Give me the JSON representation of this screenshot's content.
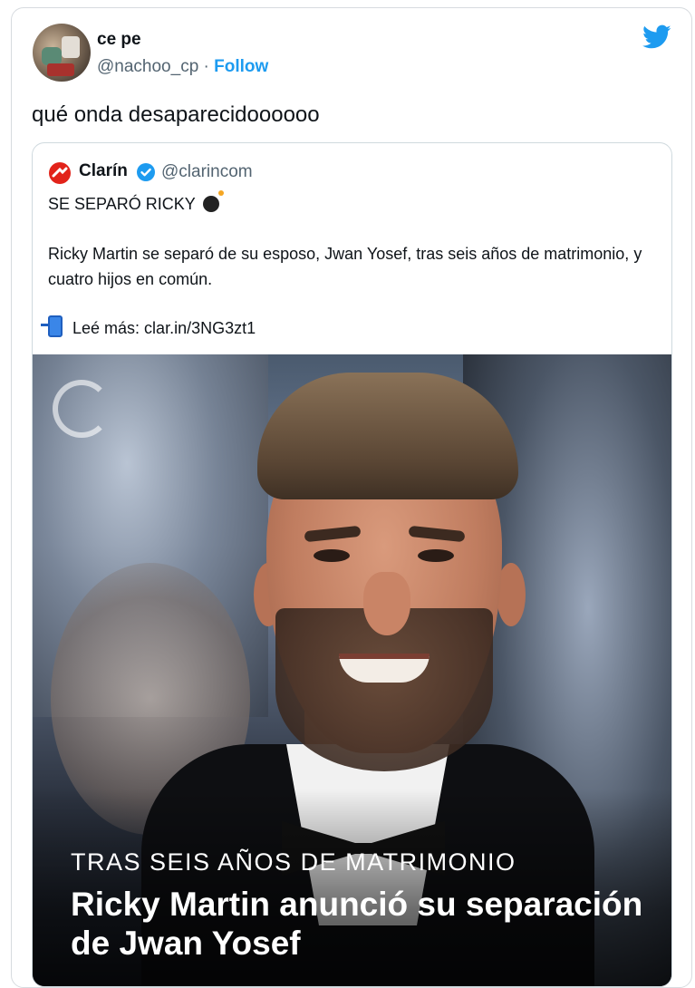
{
  "tweet": {
    "display_name": "ce pe",
    "handle": "@nachoo_cp",
    "separator": "·",
    "follow_label": "Follow",
    "text": "qué onda desaparecidoooooo"
  },
  "quoted": {
    "name": "Clarín",
    "handle": "@clarincom",
    "headline": "SE SEPARÓ RICKY",
    "body": "Ricky Martin se separó de su esposo, Jwan Yosef, tras seis años de matrimonio, y cuatro hijos en común.",
    "read_more": "Leé más: clar.in/3NG3zt1",
    "image": {
      "kicker": "TRAS SEIS AÑOS DE MATRIMONIO",
      "title": "Ricky Martin anunció su separación de Jwan Yosef"
    }
  },
  "colors": {
    "twitter_blue": "#1d9bf0",
    "clarin_red": "#e2231a",
    "verified": "#1d9bf0"
  },
  "icons": {
    "brand": "twitter-bird-icon",
    "verified": "verified-badge-icon",
    "phone": "mobile-phone-icon",
    "bomb": "bomb-emoji-icon"
  }
}
